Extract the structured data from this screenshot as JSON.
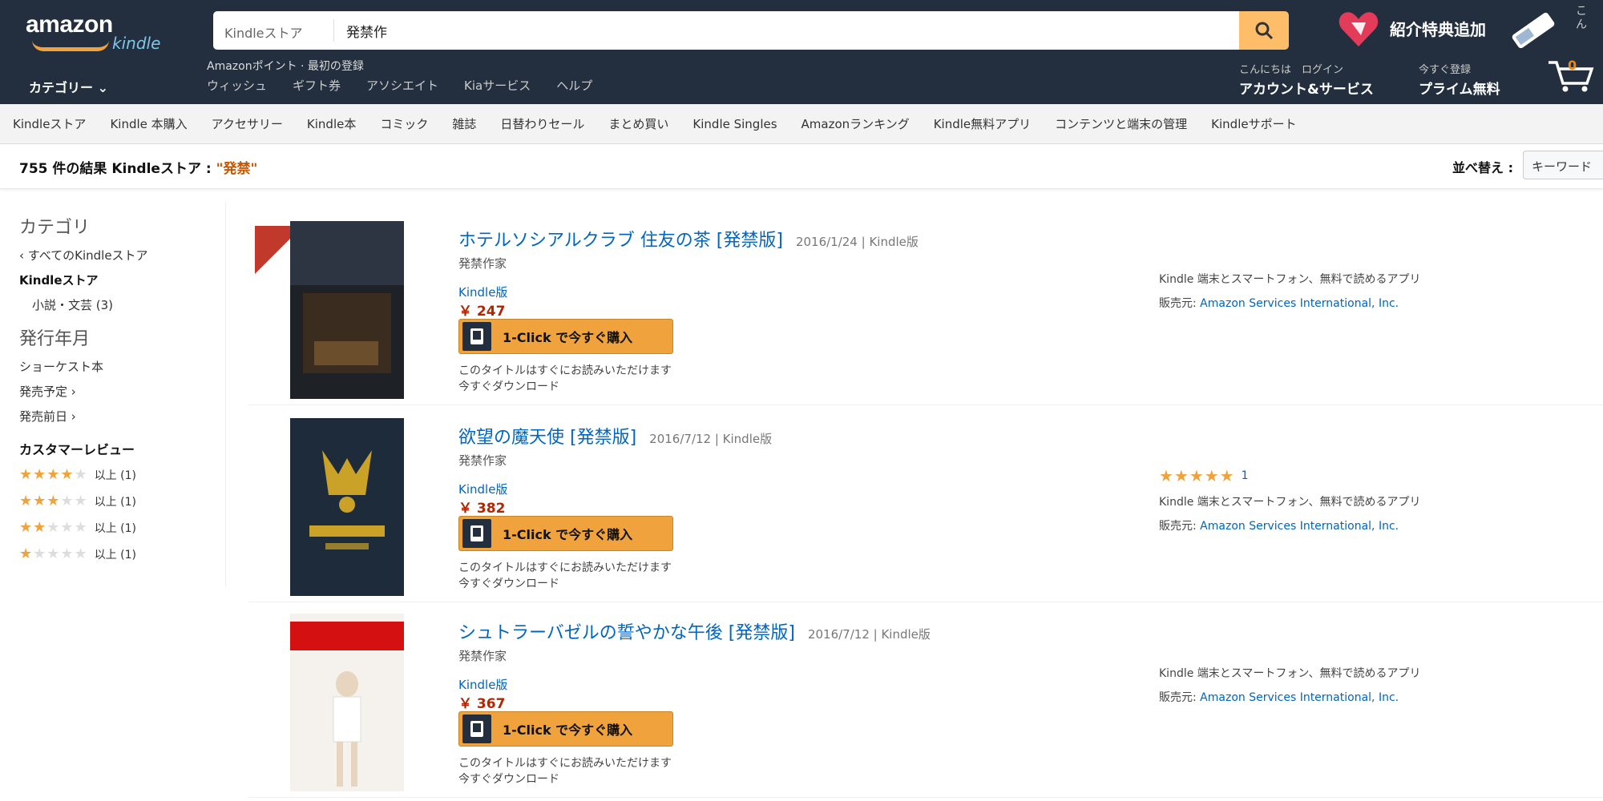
{
  "header": {
    "logo": "amazon",
    "logo_sub": "kindle",
    "category_label": "カテゴリー ⌄",
    "search_scope": "Kindleストア",
    "search_value": "発禁作",
    "promo": "Amazonポイント · 最初の登録",
    "subnav": [
      "ウィッシュ",
      "ギフト券",
      "アソシエイト",
      "Kiaサービス",
      "ヘルプ"
    ],
    "pin_text": "紹介特典追加",
    "corner_note": [
      "こ",
      "ん"
    ],
    "account_small": "こんにちは　ログイン",
    "account_big": "アカウント&サービス",
    "prime_small": "今すぐ登録",
    "prime_big": "プライム無料",
    "cart_count": "0"
  },
  "storenav": [
    "Kindleストア",
    "Kindle 本購入",
    "アクセサリー",
    "Kindle本",
    "コミック",
    "雑誌",
    "日替わりセール",
    "まとめ買い",
    "Kindle Singles",
    "Amazonランキング",
    "Kindle無料アプリ",
    "コンテンツと端末の管理",
    "Kindleサポート"
  ],
  "result_bar": {
    "text": "755 件の結果 Kindleストア : ",
    "query": "\"発禁\"",
    "sort_label": "並べ替え :",
    "sort_value": "キーワード"
  },
  "sidebar": {
    "heading": "カテゴリ",
    "all": "‹ すべてのKindleストア",
    "store": "Kindleストア",
    "sub": "小説・文芸 (3)",
    "heading2": "発行年月",
    "dates": [
      "ショーケスト本",
      "発売予定 ›",
      "発売前日 ›"
    ],
    "review_heading": "カスタマーレビュー",
    "reviews": [
      {
        "stars": 4,
        "label": "以上 (1)"
      },
      {
        "stars": 3,
        "label": "以上 (1)"
      },
      {
        "stars": 2,
        "label": "以上 (1)"
      },
      {
        "stars": 1,
        "label": "以上 (1)"
      }
    ]
  },
  "results": [
    {
      "title": "ホテルソシアルクラブ 住友の茶 [発禁版]",
      "meta": "2016/1/24 | Kindle版",
      "author": "発禁作家",
      "format": "Kindle版",
      "price": "￥ 247",
      "button": "1-Click で今すぐ購入",
      "note1": "このタイトルはすぐにお読みいただけます",
      "note2": "今すぐダウンロード",
      "rating": null,
      "rating_count": "",
      "right1": "Kindle 端末とスマートフォン、無料で読めるアプリ",
      "right2_prefix": "販売元:",
      "right2_link": "Amazon Services International, Inc.",
      "has_ribbon": true,
      "cover_theme": "dark"
    },
    {
      "title": "欲望の魔天使 [発禁版]",
      "meta": "2016/7/12 | Kindle版",
      "author": "発禁作家",
      "format": "Kindle版",
      "price": "￥ 382",
      "button": "1-Click で今すぐ購入",
      "note1": "このタイトルはすぐにお読みいただけます",
      "note2": "今すぐダウンロード",
      "rating": 5,
      "rating_count": "1",
      "right1": "Kindle 端末とスマートフォン、無料で読めるアプリ",
      "right2_prefix": "販売元:",
      "right2_link": "Amazon Services International, Inc.",
      "has_ribbon": false,
      "cover_theme": "navy"
    },
    {
      "title": "シュトラーバゼルの誓やかな午後 [発禁版]",
      "meta": "2016/7/12 | Kindle版",
      "author": "発禁作家",
      "format": "Kindle版",
      "price": "￥ 367",
      "button": "1-Click で今すぐ購入",
      "note1": "このタイトルはすぐにお読みいただけます",
      "note2": "今すぐダウンロード",
      "rating": null,
      "rating_count": "",
      "right1": "Kindle 端末とスマートフォン、無料で読めるアプリ",
      "right2_prefix": "販売元:",
      "right2_link": "Amazon Services International, Inc.",
      "has_ribbon": false,
      "cover_theme": "light"
    }
  ],
  "colors": {
    "header_bg": "#232f3e",
    "accent": "#febd69",
    "link": "#0066c0",
    "price": "#b12704",
    "star": "#f0a33c"
  }
}
